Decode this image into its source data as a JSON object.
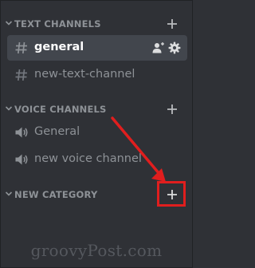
{
  "sidebar": {
    "categories": [
      {
        "label": "TEXT CHANNELS",
        "add_icon": "plus-icon",
        "channels": [
          {
            "name": "general",
            "type": "text",
            "selected": true,
            "actions": [
              "invite-people-icon",
              "gear-icon"
            ]
          },
          {
            "name": "new-text-channel",
            "type": "text",
            "selected": false
          }
        ]
      },
      {
        "label": "VOICE CHANNELS",
        "add_icon": "plus-icon",
        "channels": [
          {
            "name": "General",
            "type": "voice",
            "selected": false
          },
          {
            "name": "new voice channel",
            "type": "voice",
            "selected": false
          }
        ]
      },
      {
        "label": "NEW CATEGORY",
        "add_icon": "plus-icon",
        "channels": []
      }
    ]
  },
  "annotation": {
    "color": "#e01e1e",
    "arrow_icon": "red-arrow-icon",
    "box": "highlight-box"
  },
  "watermark": "groovyPost.com",
  "colors": {
    "background": "#2f3136",
    "muted_text": "#8e9297",
    "selected_bg": "#42464d",
    "selected_text": "#ffffff"
  }
}
